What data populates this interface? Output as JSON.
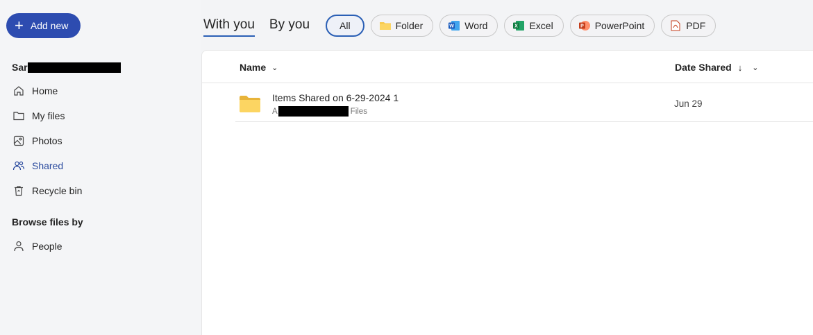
{
  "sidebar": {
    "add_new_label": "Add new",
    "user_name_visible": "Sar",
    "nav": [
      {
        "label": "Home",
        "icon": "home-icon"
      },
      {
        "label": "My files",
        "icon": "folder-icon"
      },
      {
        "label": "Photos",
        "icon": "photo-icon"
      },
      {
        "label": "Shared",
        "icon": "people-icon",
        "active": true
      },
      {
        "label": "Recycle bin",
        "icon": "recycle-bin-icon"
      }
    ],
    "browse_title": "Browse files by",
    "people_label": "People"
  },
  "tabs": [
    {
      "label": "With you",
      "active": true
    },
    {
      "label": "By you"
    }
  ],
  "filters": [
    {
      "label": "All",
      "active": true
    },
    {
      "label": "Folder",
      "icon": "folder-icon"
    },
    {
      "label": "Word",
      "icon": "word-icon"
    },
    {
      "label": "Excel",
      "icon": "excel-icon"
    },
    {
      "label": "PowerPoint",
      "icon": "powerpoint-icon"
    },
    {
      "label": "PDF",
      "icon": "pdf-icon"
    }
  ],
  "table": {
    "col_name": "Name",
    "col_date": "Date Shared",
    "rows": [
      {
        "name": "Items Shared on 6-29-2024 1",
        "sub_prefix": "A",
        "sub_suffix": "Files",
        "date": "Jun 29"
      }
    ]
  },
  "colors": {
    "accent": "#2d4cb0",
    "active_text": "#2a4a9e",
    "folder": "#f7c94b"
  }
}
